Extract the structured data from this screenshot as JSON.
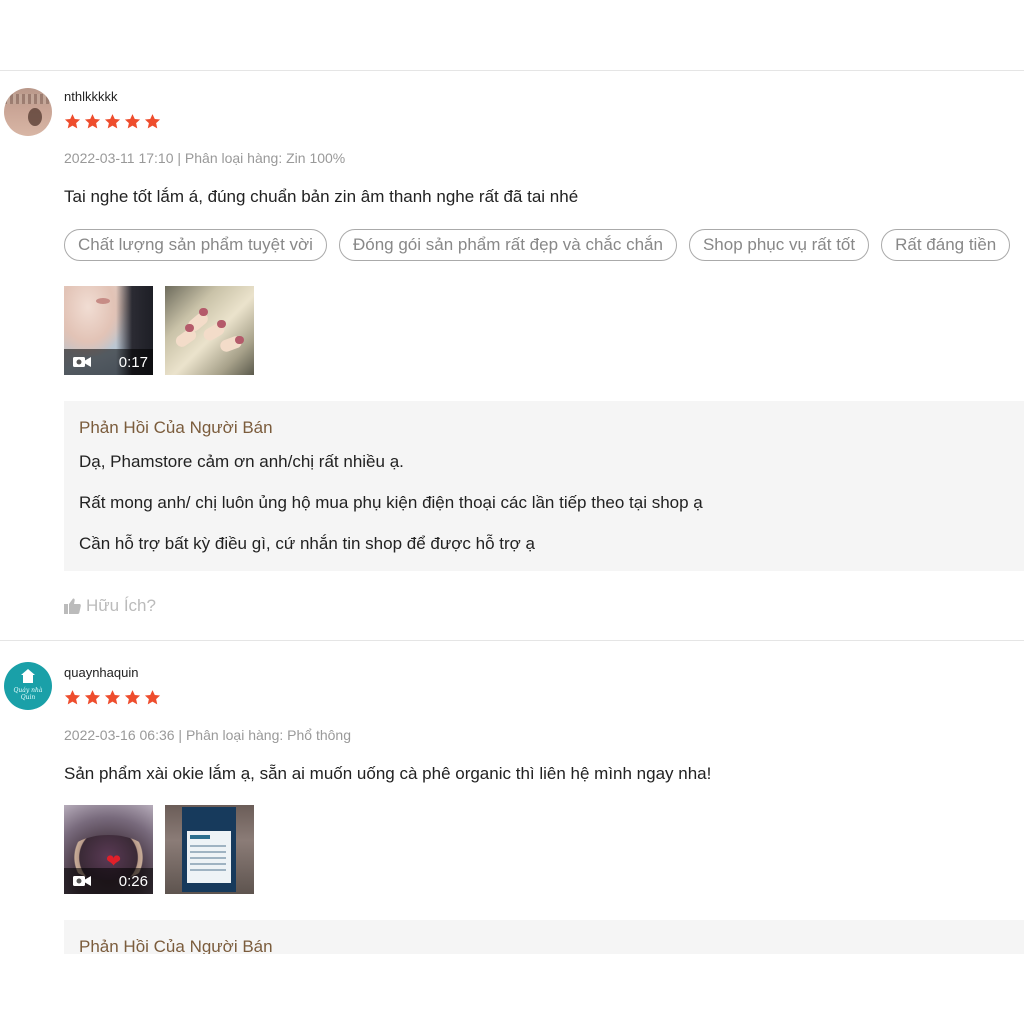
{
  "colors": {
    "star": "#ee4d2d",
    "reply_title": "#7b5c3c",
    "muted": "#999999"
  },
  "reviews": [
    {
      "username": "nthlkkkkk",
      "rating": 5,
      "meta": "2022-03-11 17:10 | Phân loại hàng: Zin 100%",
      "body": "Tai nghe tốt lắm á, đúng chuẩn bản zin âm thanh nghe rất đã tai nhé",
      "tags": [
        "Chất lượng sản phẩm tuyệt vời",
        "Đóng gói sản phẩm rất đẹp và chắc chắn",
        "Shop phục vụ rất tốt",
        "Rất đáng tiền"
      ],
      "video_duration": "0:17",
      "reply": {
        "title": "Phản Hồi Của Người Bán",
        "lines": [
          "Dạ, Phamstore cảm ơn anh/chị rất nhiều ạ.",
          "Rất mong anh/ chị luôn ủng hộ mua phụ kiện điện thoại các lần tiếp theo tại shop ạ",
          "Cần hỗ trợ bất kỳ điều gì, cứ nhắn tin shop để được hỗ trợ ạ"
        ]
      },
      "helpful_label": "Hữu Ích?"
    },
    {
      "username": "quaynhaquin",
      "rating": 5,
      "meta": "2022-03-16 06:36 | Phân loại hàng: Phổ thông",
      "body": "Sản phẩm xài okie lắm ạ, sẵn ai muốn uống cà phê organic thì liên hệ mình ngay nha!",
      "video_duration": "0:26",
      "reply": {
        "title": "Phản Hồi Của Người Bán"
      }
    }
  ],
  "icons": [
    "star-icon",
    "video-camera-icon",
    "thumbs-up-icon"
  ]
}
